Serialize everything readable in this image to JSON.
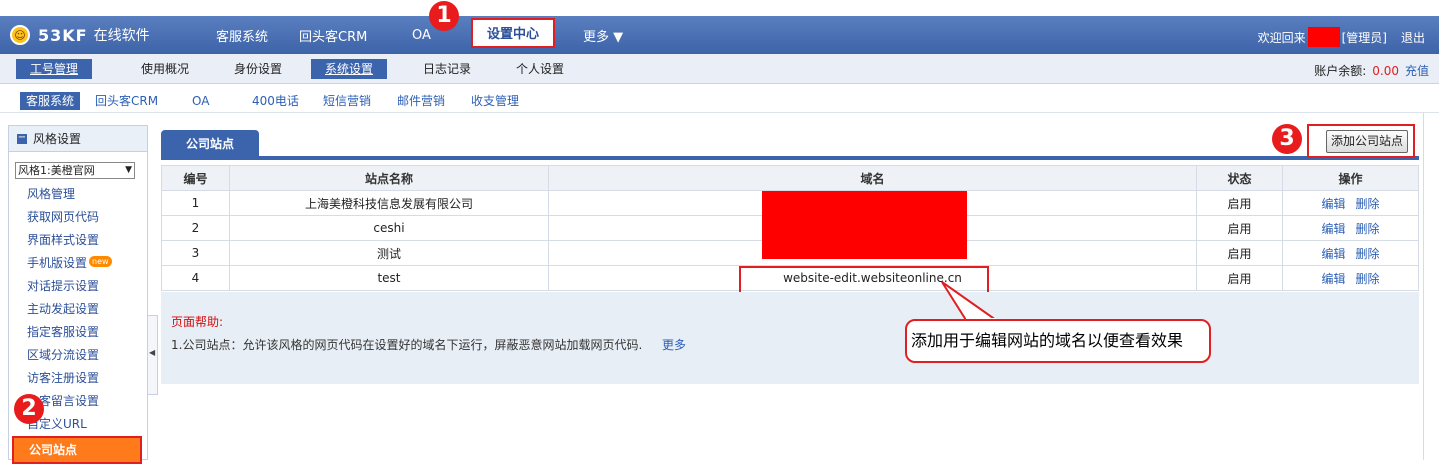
{
  "app": {
    "brand": "53KF",
    "subtitle": "在线软件",
    "logo_icon": "smiley-face"
  },
  "topnav": {
    "items": [
      "客服系统",
      "回头客CRM",
      "OA",
      "设置中心",
      "更多 ▼"
    ],
    "active": "设置中心",
    "welcome_prefix": "欢迎回来",
    "welcome_role": "[管理员]",
    "logout": "退出"
  },
  "subnav": {
    "items": [
      "工号管理",
      "使用概况",
      "身份设置",
      "系统设置",
      "日志记录",
      "个人设置"
    ],
    "selected": [
      "工号管理",
      "系统设置"
    ],
    "balance_label": "账户余额:",
    "balance_value": "0.00",
    "recharge": "充值"
  },
  "thirdnav": {
    "items": [
      "客服系统",
      "回头客CRM",
      "OA",
      "400电话",
      "短信营销",
      "邮件营销",
      "收支管理"
    ],
    "selected": "客服系统"
  },
  "sidebar": {
    "header": "风格设置",
    "style_select": "风格1:美橙官网",
    "items": [
      "风格管理",
      "获取网页代码",
      "界面样式设置",
      "手机版设置",
      "对话提示设置",
      "主动发起设置",
      "指定客服设置",
      "区域分流设置",
      "访客注册设置",
      "访客留言设置",
      "自定义URL",
      "公司站点"
    ],
    "new_badge": "new",
    "current": "公司站点"
  },
  "main": {
    "tab": "公司站点",
    "add_button": "添加公司站点",
    "columns": [
      "编号",
      "站点名称",
      "域名",
      "状态",
      "操作"
    ],
    "rows": [
      {
        "id": "1",
        "name": "上海美橙科技信息发展有限公司",
        "domain": "",
        "status": "启用",
        "edit": "编辑",
        "delete": "删除"
      },
      {
        "id": "2",
        "name": "ceshi",
        "domain": "",
        "status": "启用",
        "edit": "编辑",
        "delete": "删除"
      },
      {
        "id": "3",
        "name": "测试",
        "domain": "",
        "status": "启用",
        "edit": "编辑",
        "delete": "删除"
      },
      {
        "id": "4",
        "name": "test",
        "domain": "website-edit.websiteonline.cn",
        "status": "启用",
        "edit": "编辑",
        "delete": "删除"
      }
    ],
    "help_title": "页面帮助:",
    "help_text": "1.公司站点：允许该风格的网页代码在设置好的域名下运行，屏蔽恶意网站加载网页代码.",
    "help_more": "更多"
  },
  "annotations": {
    "callout": "添加用于编辑网站的域名以便查看效果",
    "badges": [
      "1",
      "2",
      "3"
    ],
    "highlight_color": "#e02020"
  }
}
